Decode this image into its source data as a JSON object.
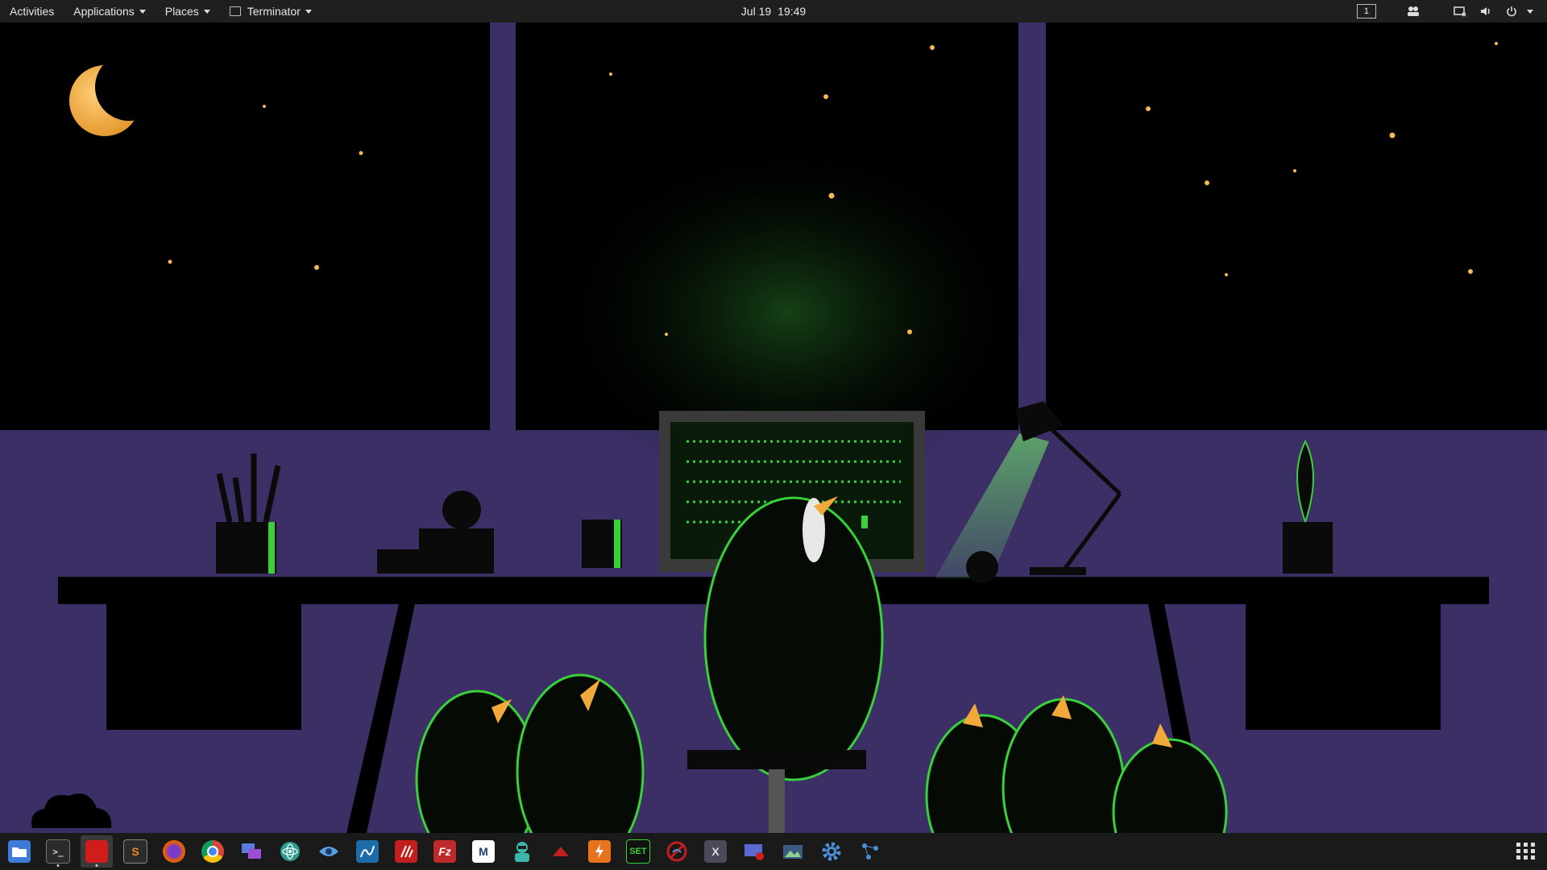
{
  "topbar": {
    "activities": "Activities",
    "applications": "Applications",
    "places": "Places",
    "active_app": "Terminator",
    "date": "Jul 19",
    "time": "19:49",
    "workspace": "1"
  },
  "tray_icons": [
    "users-icon",
    "screen-icon",
    "volume-icon",
    "power-icon",
    "chevron-down-icon"
  ],
  "dock": {
    "items": [
      {
        "name": "files",
        "label": "",
        "color": "#3d7bd6"
      },
      {
        "name": "terminal",
        "label": "",
        "color": "#2b2b2b"
      },
      {
        "name": "red-app",
        "label": "",
        "color": "#d11c1c"
      },
      {
        "name": "sublime-text",
        "label": "S",
        "color": "#2c2c2c"
      },
      {
        "name": "firefox",
        "label": "",
        "color": "#e66000"
      },
      {
        "name": "chrome",
        "label": "",
        "color": "#1a73e8"
      },
      {
        "name": "multi-window-app",
        "label": "",
        "color": "#7a4fd6"
      },
      {
        "name": "atom",
        "label": "",
        "color": "#3aa89a"
      },
      {
        "name": "eye-app",
        "label": "",
        "color": "#5aa0e0"
      },
      {
        "name": "wireshark",
        "label": "",
        "color": "#1b6ca8"
      },
      {
        "name": "red-stack-app",
        "label": "",
        "color": "#c21f1f"
      },
      {
        "name": "filezilla",
        "label": "Fz",
        "color": "#bf2a2a"
      },
      {
        "name": "maltego",
        "label": "M",
        "color": "#1d3f7a"
      },
      {
        "name": "avatar-app",
        "label": "",
        "color": "#3bb6a8"
      },
      {
        "name": "arrow-up-app",
        "label": "",
        "color": "#c21f1f"
      },
      {
        "name": "burp",
        "label": "",
        "color": "#e8731f"
      },
      {
        "name": "set",
        "label": "SET",
        "color": "#111111"
      },
      {
        "name": "no-wifi-app",
        "label": "",
        "color": "#c21f1f"
      },
      {
        "name": "x-tool",
        "label": "X",
        "color": "#4a4a5a"
      },
      {
        "name": "screen-recorder",
        "label": "",
        "color": "#5a6ad0"
      },
      {
        "name": "image-viewer",
        "label": "",
        "color": "#3d5a80"
      },
      {
        "name": "settings",
        "label": "",
        "color": "#4a90d9"
      },
      {
        "name": "network-app",
        "label": "",
        "color": "#4a90d9"
      }
    ]
  },
  "colors": {
    "night": "#000000",
    "wall": "#3b2f66",
    "accent_green": "#39ff14",
    "star": "#f7b955",
    "moon": "#f0b050"
  }
}
